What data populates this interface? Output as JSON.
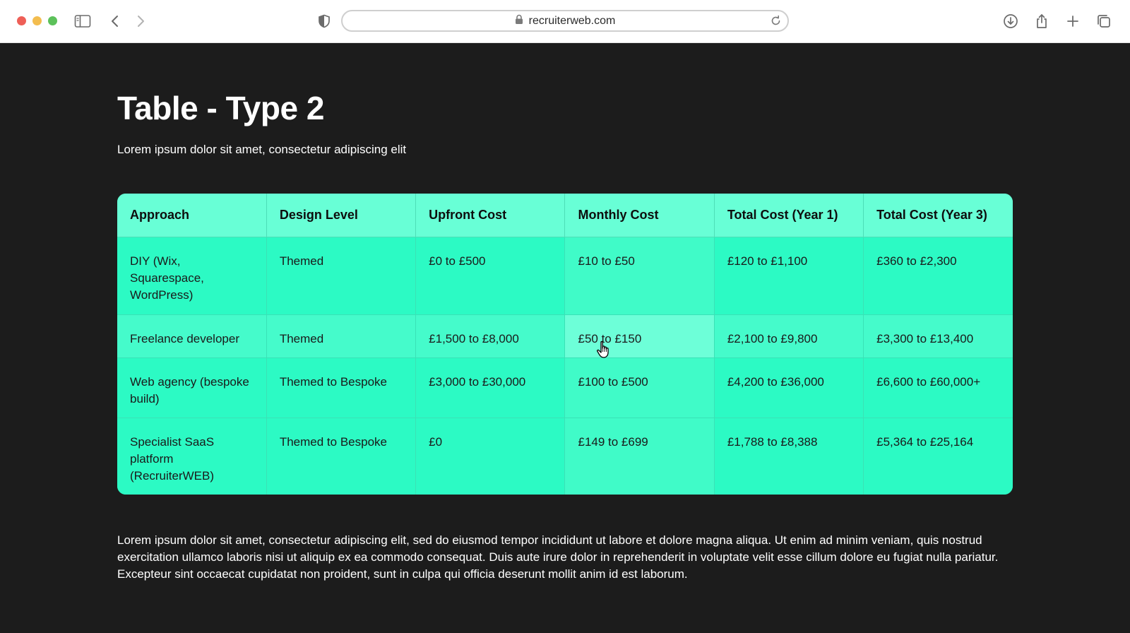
{
  "browser": {
    "url": "recruiterweb.com"
  },
  "page": {
    "title": "Table - Type 2",
    "subtitle": "Lorem ipsum dolor sit amet, consectetur adipiscing elit",
    "body_text": "Lorem ipsum dolor sit amet, consectetur adipiscing elit, sed do eiusmod tempor incididunt ut labore et dolore magna aliqua. Ut enim ad minim veniam, quis nostrud exercitation ullamco laboris nisi ut aliquip ex ea commodo consequat. Duis aute irure dolor in reprehenderit in voluptate velit esse cillum dolore eu fugiat nulla pariatur. Excepteur sint occaecat cupidatat non proident, sunt in culpa qui officia deserunt mollit anim id est laborum."
  },
  "table": {
    "headers": [
      "Approach",
      "Design Level",
      "Upfront Cost",
      "Monthly Cost",
      "Total Cost (Year 1)",
      "Total Cost (Year 3)"
    ],
    "rows": [
      [
        "DIY (Wix, Squarespace, WordPress)",
        "Themed",
        "£0 to £500",
        "£10 to £50",
        "£120 to £1,100",
        "£360 to £2,300"
      ],
      [
        "Freelance developer",
        "Themed",
        "£1,500 to £8,000",
        "£50 to £150",
        "£2,100 to £9,800",
        "£3,300 to £13,400"
      ],
      [
        "Web agency (bespoke build)",
        "Themed to Bespoke",
        "£3,000 to £30,000",
        "£100 to £500",
        "£4,200 to £36,000",
        "£6,600 to £60,000+"
      ],
      [
        "Specialist SaaS platform (RecruiterWEB)",
        "Themed to Bespoke",
        "£0",
        "£149 to £699",
        "£1,788 to £8,388",
        "£5,364 to £25,164"
      ]
    ]
  },
  "colors": {
    "page_background": "#1c1c1c",
    "table_header": "#68ffd6",
    "table_body": "#2cfac4",
    "table_hover_cell": "#6dffd8",
    "text_light": "#ffffff",
    "text_dark": "#1a1a1a"
  },
  "icons": {
    "toolbar": [
      "sidebar-icon",
      "back-icon",
      "forward-icon",
      "shield-icon",
      "lock-icon",
      "reload-icon",
      "download-icon",
      "share-icon",
      "new-tab-icon",
      "tabs-overview-icon"
    ],
    "pointer": "hand-cursor-icon"
  }
}
